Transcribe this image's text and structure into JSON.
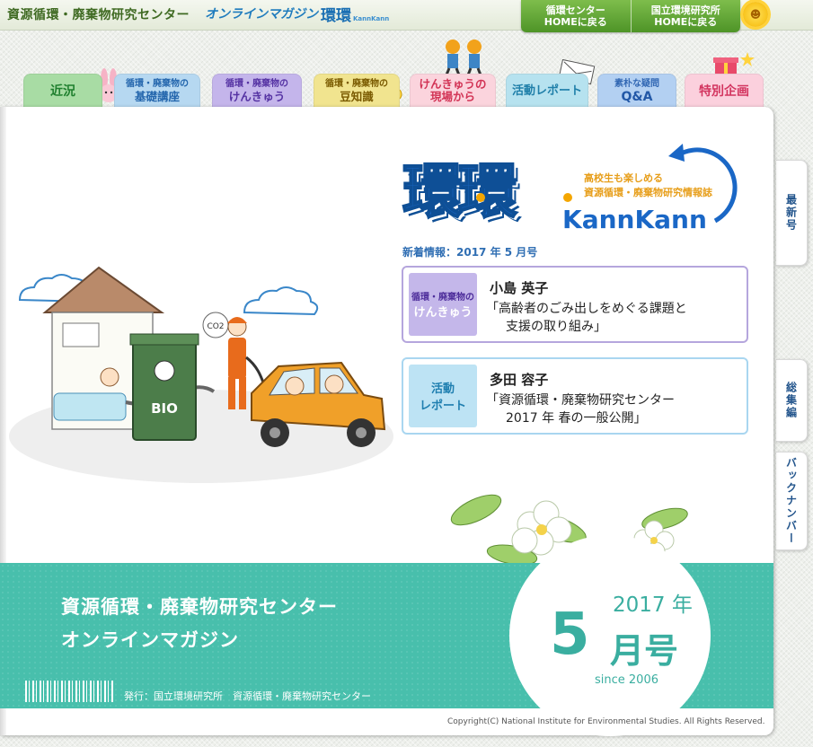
{
  "header": {
    "site_title": "資源循環・廃棄物研究センター",
    "magazine_title": "オンラインマガジン",
    "magazine_logo": "環環",
    "magazine_logo_sub": "KannKann",
    "buttons": [
      {
        "line1": "循環センター",
        "line2": "HOMEに戻る"
      },
      {
        "line1": "国立環境研究所",
        "line2": "HOMEに戻る"
      }
    ]
  },
  "tabs": [
    {
      "main": "近況"
    },
    {
      "sub": "循環・廃棄物の",
      "main": "基礎講座"
    },
    {
      "sub": "循環・廃棄物の",
      "main": "けんきゅう"
    },
    {
      "sub": "循環・廃棄物の",
      "main": "豆知識"
    },
    {
      "main": "けんきゅうの",
      "main2": "現場から"
    },
    {
      "main": "活動レポート"
    },
    {
      "sub": "素朴な疑問",
      "main": "Q&A"
    },
    {
      "main": "特別企画"
    }
  ],
  "side_tabs": [
    "最新号",
    "総集編",
    "バックナンバー"
  ],
  "logo": {
    "main": "環環",
    "latin": "KannKann",
    "tagline1": "高校生も楽しめる",
    "tagline2": "資源循環・廃棄物研究情報誌"
  },
  "news_label": "新着情報：2017 年 5 月号",
  "news": [
    {
      "badge_sub": "循環・廃棄物の",
      "badge_main": "けんきゅう",
      "author": "小島 英子",
      "title_line1": "「高齢者のごみ出しをめぐる課題と",
      "title_line2": "支援の取り組み」"
    },
    {
      "badge_sub": "活動",
      "badge_main": "レポート",
      "author": "多田 容子",
      "title_line1": "「資源循環・廃棄物研究センター",
      "title_line2": "2017 年 春の一般公開」"
    }
  ],
  "illustration": {
    "bin_label": "BIO",
    "gas_label": "CO2"
  },
  "footer": {
    "line1": "資源循環・廃棄物研究センター",
    "line2": "オンラインマガジン",
    "publisher": "発行：国立環境研究所　資源循環・廃棄物研究センター",
    "issue_year": "2017 年",
    "issue_number": "5",
    "issue_month": "月号",
    "since": "since 2006",
    "copyright": "Copyright(C) National Institute for Environmental Studies. All Rights Reserved."
  },
  "colors": {
    "teal": "#48bfac",
    "brand_blue": "#1a67c6",
    "accent_orange": "#f4a600",
    "header_green": "#5ea332"
  }
}
